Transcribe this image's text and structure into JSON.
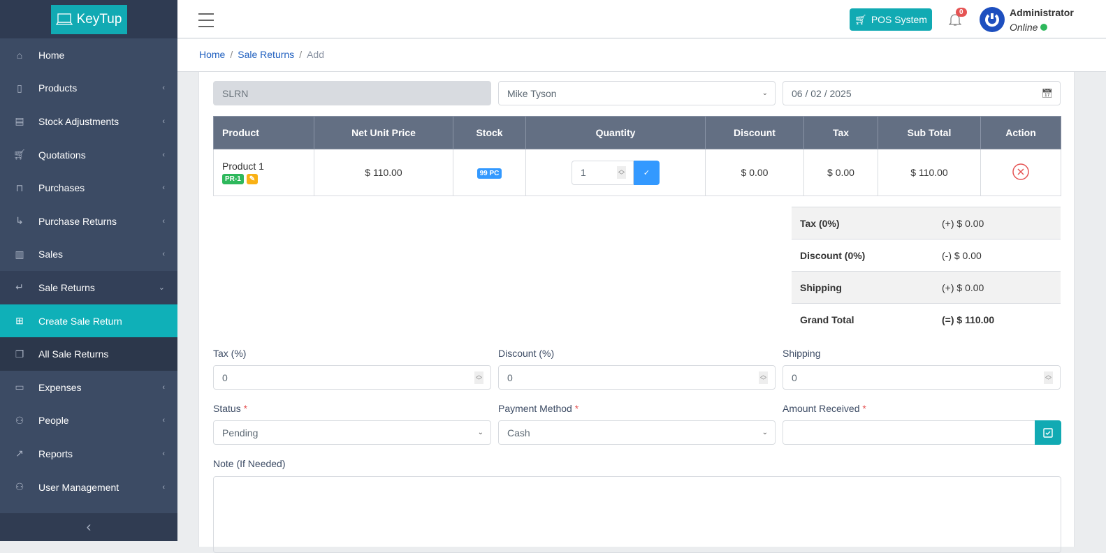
{
  "brand": "KeyTup",
  "sidebar": {
    "items": [
      {
        "label": "Home",
        "icon": "home-icon"
      },
      {
        "label": "Products",
        "icon": "bookmark-icon"
      },
      {
        "label": "Stock Adjustments",
        "icon": "clipboard-icon"
      },
      {
        "label": "Quotations",
        "icon": "cart-icon"
      },
      {
        "label": "Purchases",
        "icon": "bag-icon"
      },
      {
        "label": "Purchase Returns",
        "icon": "return-right-icon"
      },
      {
        "label": "Sales",
        "icon": "receipt-icon"
      },
      {
        "label": "Sale Returns",
        "icon": "return-left-icon"
      },
      {
        "label": "Create Sale Return",
        "icon": "plus-square-icon"
      },
      {
        "label": "All Sale Returns",
        "icon": "copy-icon"
      },
      {
        "label": "Expenses",
        "icon": "wallet-icon"
      },
      {
        "label": "People",
        "icon": "people-icon"
      },
      {
        "label": "Reports",
        "icon": "chart-icon"
      },
      {
        "label": "User Management",
        "icon": "users-icon"
      }
    ]
  },
  "header": {
    "pos_label": "POS System",
    "notifications": "0",
    "user_name": "Administrator",
    "user_status": "Online"
  },
  "breadcrumb": {
    "home": "Home",
    "section": "Sale Returns",
    "current": "Add"
  },
  "form": {
    "reference": "SLRN",
    "customer": "Mike Tyson",
    "date": "06 / 02 / 2025"
  },
  "table": {
    "headers": [
      "Product",
      "Net Unit Price",
      "Stock",
      "Quantity",
      "Discount",
      "Tax",
      "Sub Total",
      "Action"
    ],
    "rows": [
      {
        "product": "Product 1",
        "code": "PR-1",
        "price": "$ 110.00",
        "stock": "99 PC",
        "quantity": "1",
        "discount": "$ 0.00",
        "tax": "$ 0.00",
        "subtotal": "$ 110.00"
      }
    ]
  },
  "summary": [
    {
      "label": "Tax (0%)",
      "value": "(+) $ 0.00"
    },
    {
      "label": "Discount (0%)",
      "value": "(-) $ 0.00"
    },
    {
      "label": "Shipping",
      "value": "(+) $ 0.00"
    },
    {
      "label": "Grand Total",
      "value": "(=) $ 110.00"
    }
  ],
  "fields": {
    "tax_label": "Tax (%)",
    "tax": "0",
    "discount_label": "Discount (%)",
    "discount": "0",
    "shipping_label": "Shipping",
    "shipping": "0",
    "status_label": "Status",
    "status": "Pending",
    "payment_label": "Payment Method",
    "payment": "Cash",
    "amount_label": "Amount Received",
    "amount": "",
    "note_label": "Note (If Needed)",
    "required": "*"
  }
}
